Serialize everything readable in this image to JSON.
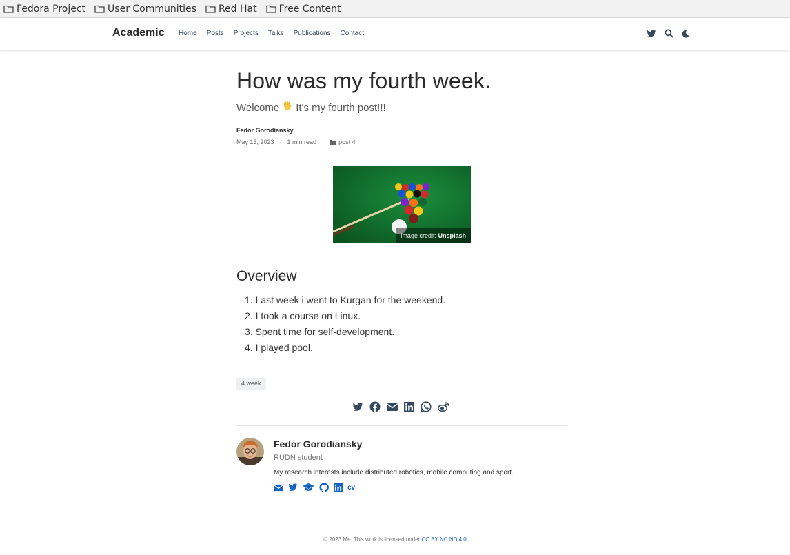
{
  "bookmarks": [
    "Fedora Project",
    "User Communities",
    "Red Hat",
    "Free Content"
  ],
  "navbar": {
    "brand": "Academic",
    "links": [
      "Home",
      "Posts",
      "Projects",
      "Talks",
      "Publications",
      "Contact"
    ],
    "icons": [
      "twitter-icon",
      "search-icon",
      "moon-icon"
    ]
  },
  "article": {
    "title": "How was my fourth week.",
    "subtitle_before": "Welcome",
    "subtitle_after": "It's my fourth post!!!",
    "author": "Fedor Gorodiansky",
    "date": "May 13, 2023",
    "read_time": "1 min read",
    "category": "post 4",
    "image_credit_label": "Image credit:",
    "image_credit_source": "Unsplash",
    "section_title": "Overview",
    "list_items": [
      "1. Last week i went to Kurgan for the weekend.",
      "2. I took a course on Linux.",
      "3. Spent time for self-development.",
      "4. I played pool."
    ],
    "tag": "4 week"
  },
  "share_icons": [
    "twitter-icon",
    "facebook-icon",
    "envelope-icon",
    "linkedin-icon",
    "whatsapp-icon",
    "weibo-icon"
  ],
  "author_card": {
    "name": "Fedor Gorodiansky",
    "role": "RUDN student",
    "bio": "My research interests include distributed robotics, mobile computing and sport.",
    "cv_label": "cv"
  },
  "footer": {
    "text": "© 2023 Me. This work is licensed under ",
    "license": "CC BY NC ND 4.0"
  },
  "colors": {
    "accent": "#1565c0",
    "text": "#34495e",
    "table_felt": "#0d6b2a"
  }
}
